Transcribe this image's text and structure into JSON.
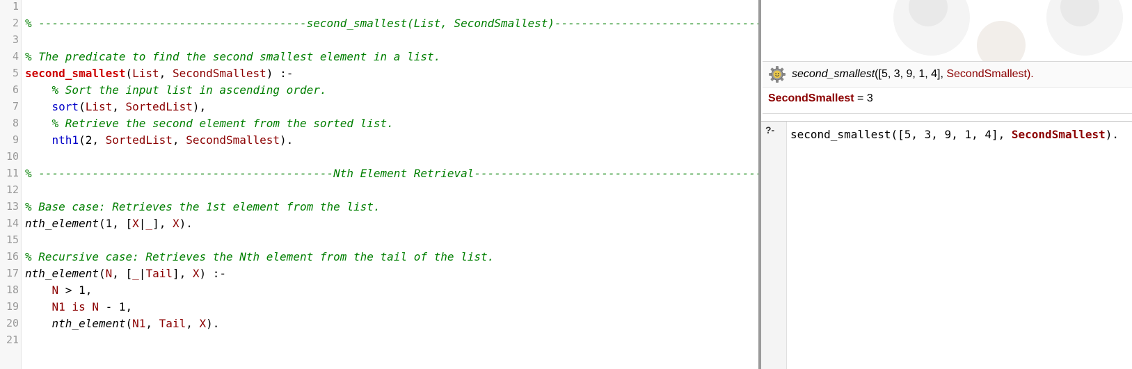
{
  "editor": {
    "line_numbers": [
      "1",
      "2",
      "3",
      "4",
      "5",
      "6",
      "7",
      "8",
      "9",
      "10",
      "11",
      "12",
      "13",
      "14",
      "15",
      "16",
      "17",
      "18",
      "19",
      "20",
      "21"
    ],
    "line2": {
      "prefix": "% ----------------------------------------",
      "title": "second_smallest(List, SecondSmallest)",
      "suffix": "--------------------------------------------"
    },
    "line4": "% The predicate to find the second smallest element in a list.",
    "line5": {
      "head": "second_smallest",
      "open": "(",
      "v1": "List",
      "sep": ", ",
      "v2": "SecondSmallest",
      "close": ") :-"
    },
    "line6": "    % Sort the input list in ascending order.",
    "line7": {
      "indent": "    ",
      "pred": "sort",
      "open": "(",
      "v1": "List",
      "sep": ", ",
      "v2": "SortedList",
      "close": "),"
    },
    "line8": "    % Retrieve the second element from the sorted list.",
    "line9": {
      "indent": "    ",
      "pred": "nth1",
      "open": "(2, ",
      "v1": "SortedList",
      "sep": ", ",
      "v2": "SecondSmallest",
      "close": ")."
    },
    "line11": {
      "prefix": "% --------------------------------------------",
      "title": "Nth Element Retrieval",
      "suffix": "--------------------------------------------------------"
    },
    "line13": "% Base case: Retrieves the 1st element from the list.",
    "line14": {
      "pred": "nth_element",
      "p1": "(1, [",
      "v1": "X",
      "p2": "|",
      "v2": "_",
      "p3": "], ",
      "v3": "X",
      "p4": ")."
    },
    "line16": "% Recursive case: Retrieves the Nth element from the tail of the list.",
    "line17": {
      "pred": "nth_element",
      "p1": "(",
      "v1": "N",
      "p2": ", [",
      "v2": "_",
      "p3": "|",
      "v3": "Tail",
      "p4": "], ",
      "v4": "X",
      "p5": ") :-"
    },
    "line18": {
      "indent": "    ",
      "v1": "N",
      "rest": " > 1,"
    },
    "line19": {
      "indent": "    ",
      "v1": "N1",
      "op": " is ",
      "v2": "N",
      "rest": " - 1,"
    },
    "line20": {
      "indent": "    ",
      "pred": "nth_element",
      "p1": "(",
      "v1": "N1",
      "p2": ", ",
      "v2": "Tail",
      "p3": ", ",
      "v3": "X",
      "p4": ")."
    }
  },
  "answer": {
    "icon": "gear-icon",
    "query_pred": "second_smallest",
    "query_args": "([5, 3, 9, 1, 4], ",
    "query_var": "SecondSmallest",
    "query_end": ").",
    "result_var": "SecondSmallest",
    "result_value": " = 3"
  },
  "console": {
    "prompt": "?-",
    "input_prefix": "second_smallest([5, 3, 9, 1, 4], ",
    "input_var": "SecondSmallest",
    "input_suffix": ")."
  },
  "colors": {
    "comment": "#007f00",
    "predicate_head": "#cc0000",
    "variable": "#8b0000",
    "builtin": "#0000c8"
  }
}
